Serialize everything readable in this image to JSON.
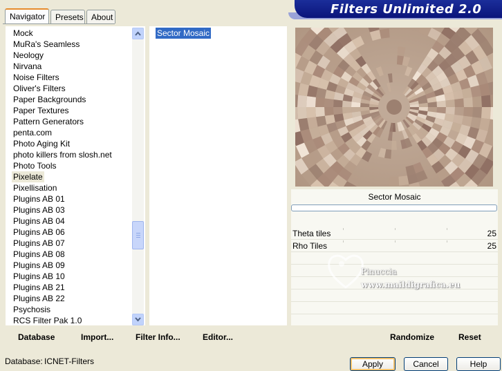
{
  "tabs": [
    {
      "label": "Navigator",
      "active": true
    },
    {
      "label": "Presets",
      "active": false
    },
    {
      "label": "About",
      "active": false
    }
  ],
  "banner": {
    "title": "Filters Unlimited 2.0"
  },
  "categories": [
    "Mock",
    "MuRa's Seamless",
    "Neology",
    "Nirvana",
    "Noise Filters",
    "Oliver's Filters",
    "Paper Backgrounds",
    "Paper Textures",
    "Pattern Generators",
    "penta.com",
    "Photo Aging Kit",
    "photo killers from slosh.net",
    "Photo Tools",
    "Pixelate",
    "Pixellisation",
    "Plugins AB 01",
    "Plugins AB 03",
    "Plugins AB 04",
    "Plugins AB 06",
    "Plugins AB 07",
    "Plugins AB 08",
    "Plugins AB 09",
    "Plugins AB 10",
    "Plugins AB 21",
    "Plugins AB 22",
    "Psychosis",
    "RCS Filter Pak 1.0"
  ],
  "selected_category": "Pixelate",
  "filters": [
    "Sector Mosaic"
  ],
  "toolbar": {
    "database_label": "Database",
    "import_label": "Import...",
    "filter_info_label": "Filter Info...",
    "editor_label": "Editor...",
    "randomize_label": "Randomize",
    "reset_label": "Reset"
  },
  "preview": {
    "filter_name": "Sector Mosaic"
  },
  "params": [
    {
      "label": "Theta tiles",
      "value": "25"
    },
    {
      "label": "Rho Tiles",
      "value": "25"
    }
  ],
  "watermark": {
    "line1": "Pinuccia",
    "line2": "www.maildigrafica.eu"
  },
  "status": {
    "label": "Database:",
    "value": "ICNET-Filters"
  },
  "buttons": {
    "apply": "Apply",
    "cancel": "Cancel",
    "help": "Help"
  },
  "colors": {
    "accent": "#316AC5",
    "banner": "#0A147A",
    "preview_base": "#B8A08E"
  }
}
